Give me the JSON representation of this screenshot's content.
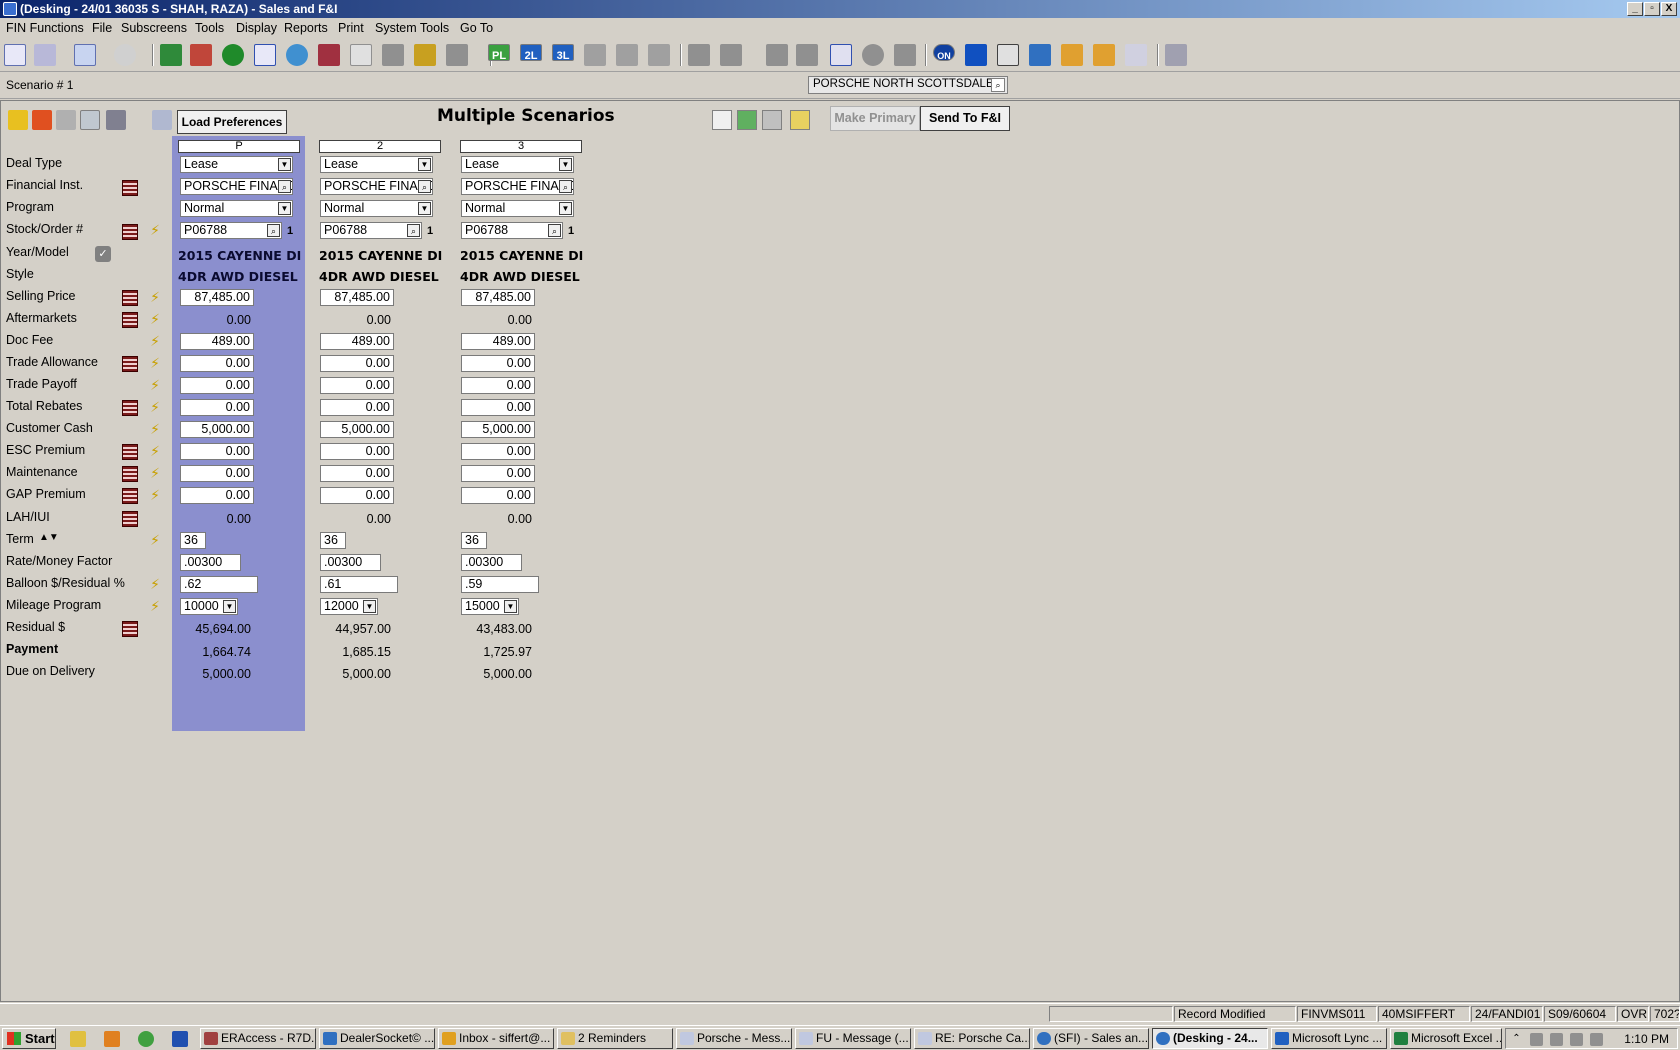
{
  "title": "(Desking - 24/01 36035 S - SHAH, RAZA) - Sales and F&I",
  "window_controls": [
    "_",
    "▫",
    "X"
  ],
  "menu": [
    "FIN Functions",
    "File",
    "Subscreens",
    "Tools",
    "Display",
    "Reports",
    "Print",
    "System Tools",
    "Go To"
  ],
  "toolbar": {
    "pl": "PL",
    "l2": "2L",
    "l3": "3L",
    "on": "ON"
  },
  "scenario_label": "Scenario # 1",
  "dealer": "PORSCHE NORTH SCOTTSDALE",
  "load_preferences": "Load Preferences",
  "heading": "Multiple Scenarios",
  "make_primary": "Make Primary",
  "send_fi": "Send To F&I",
  "labels": {
    "deal_type": "Deal Type",
    "financial_inst": "Financial Inst.",
    "program": "Program",
    "stock_order": "Stock/Order #",
    "year_model": "Year/Model",
    "style": "Style",
    "selling_price": "Selling Price",
    "aftermarkets": "Aftermarkets",
    "doc_fee": "Doc Fee",
    "trade_allowance": "Trade Allowance",
    "trade_payoff": "Trade Payoff",
    "total_rebates": "Total Rebates",
    "customer_cash": "Customer Cash",
    "esc_premium": "ESC Premium",
    "maintenance": "Maintenance",
    "gap_premium": "GAP Premium",
    "lah_iui": "LAH/IUI",
    "term": "Term",
    "rate_money_factor": "Rate/Money Factor",
    "balloon_residual": "Balloon $/Residual %",
    "mileage_program": "Mileage Program",
    "residual_dollar": "Residual $",
    "payment": "Payment",
    "due_on_delivery": "Due on Delivery"
  },
  "scenarios": [
    {
      "header": "P",
      "deal_type": "Lease",
      "financial_inst": "PORSCHE FINANCIAL",
      "program": "Normal",
      "stock": "P06788",
      "stock_count": "1",
      "year_model": "2015 CAYENNE DI",
      "style": "4DR AWD DIESEL",
      "selling_price": "87,485.00",
      "aftermarkets": "0.00",
      "doc_fee": "489.00",
      "trade_allowance": "0.00",
      "trade_payoff": "0.00",
      "total_rebates": "0.00",
      "customer_cash": "5,000.00",
      "esc_premium": "0.00",
      "maintenance": "0.00",
      "gap_premium": "0.00",
      "lah_iui": "0.00",
      "term": "36",
      "rate": ".00300",
      "residual_pct": ".62",
      "mileage": "10000",
      "residual_dollar": "45,694.00",
      "payment": "1,664.74",
      "due_on_delivery": "5,000.00"
    },
    {
      "header": "2",
      "deal_type": "Lease",
      "financial_inst": "PORSCHE FINANCIAL",
      "program": "Normal",
      "stock": "P06788",
      "stock_count": "1",
      "year_model": "2015 CAYENNE DI",
      "style": "4DR AWD DIESEL",
      "selling_price": "87,485.00",
      "aftermarkets": "0.00",
      "doc_fee": "489.00",
      "trade_allowance": "0.00",
      "trade_payoff": "0.00",
      "total_rebates": "0.00",
      "customer_cash": "5,000.00",
      "esc_premium": "0.00",
      "maintenance": "0.00",
      "gap_premium": "0.00",
      "lah_iui": "0.00",
      "term": "36",
      "rate": ".00300",
      "residual_pct": ".61",
      "mileage": "12000",
      "residual_dollar": "44,957.00",
      "payment": "1,685.15",
      "due_on_delivery": "5,000.00"
    },
    {
      "header": "3",
      "deal_type": "Lease",
      "financial_inst": "PORSCHE FINANCIAL",
      "program": "Normal",
      "stock": "P06788",
      "stock_count": "1",
      "year_model": "2015 CAYENNE DI",
      "style": "4DR AWD DIESEL",
      "selling_price": "87,485.00",
      "aftermarkets": "0.00",
      "doc_fee": "489.00",
      "trade_allowance": "0.00",
      "trade_payoff": "0.00",
      "total_rebates": "0.00",
      "customer_cash": "5,000.00",
      "esc_premium": "0.00",
      "maintenance": "0.00",
      "gap_premium": "0.00",
      "lah_iui": "0.00",
      "term": "36",
      "rate": ".00300",
      "residual_pct": ".59",
      "mileage": "15000",
      "residual_dollar": "43,483.00",
      "payment": "1,725.97",
      "due_on_delivery": "5,000.00"
    }
  ],
  "status": [
    "Record Modified",
    "FINVMS011",
    "40MSIFFERT",
    "24/FANDI01",
    "S09/60604",
    "OVR",
    "702?"
  ],
  "taskbar": {
    "start": "Start",
    "tasks": [
      "ERAccess - R7D...",
      "DealerSocket© ...",
      "Inbox - siffert@...",
      "2 Reminders",
      "Porsche  - Mess...",
      "FU - Message (...",
      "RE: Porsche Ca...",
      "(SFI) - Sales an...",
      "(Desking - 24...",
      "Microsoft Lync ...",
      "Microsoft Excel ..."
    ],
    "clock": "1:10 PM"
  },
  "colors": {
    "primary_column": "#8b8fce",
    "titlebar": "#0a246a"
  }
}
